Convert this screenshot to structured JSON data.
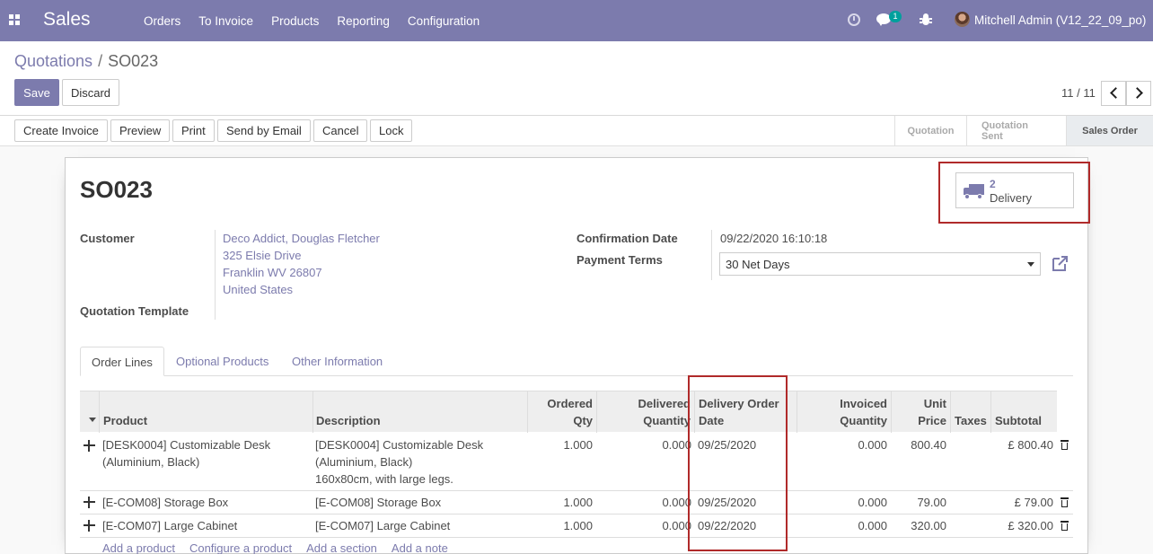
{
  "navbar": {
    "app_title": "Sales",
    "menu": [
      "Orders",
      "To Invoice",
      "Products",
      "Reporting",
      "Configuration"
    ],
    "chat_count": "1",
    "user": "Mitchell Admin (V12_22_09_po)"
  },
  "breadcrumb": {
    "parent": "Quotations",
    "separator": "/",
    "current": "SO023"
  },
  "buttons": {
    "save": "Save",
    "discard": "Discard"
  },
  "pager": {
    "value": "11 / 11"
  },
  "status_actions": [
    "Create Invoice",
    "Preview",
    "Print",
    "Send by Email",
    "Cancel",
    "Lock"
  ],
  "stages": [
    "Quotation",
    "Quotation Sent",
    "Sales Order"
  ],
  "record": {
    "name": "SO023",
    "smart_button": {
      "value": "2",
      "label": "Delivery"
    },
    "customer_label": "Customer",
    "customer_lines": [
      "Deco Addict, Douglas Fletcher",
      "325 Elsie Drive",
      "Franklin WV 26807",
      "United States"
    ],
    "template_label": "Quotation Template",
    "confirmation_label": "Confirmation Date",
    "confirmation_value": "09/22/2020 16:10:18",
    "payment_label": "Payment Terms",
    "payment_value": "30 Net Days"
  },
  "tabs": [
    "Order Lines",
    "Optional Products",
    "Other Information"
  ],
  "table": {
    "headers": {
      "product": "Product",
      "description": "Description",
      "ordered_1": "Ordered",
      "ordered_2": "Qty",
      "delivered_1": "Delivered",
      "delivered_2": "Quantity",
      "delivery_date_1": "Delivery Order",
      "delivery_date_2": "Date",
      "invoiced_1": "Invoiced",
      "invoiced_2": "Quantity",
      "price_1": "Unit",
      "price_2": "Price",
      "taxes": "Taxes",
      "subtotal": "Subtotal"
    },
    "rows": [
      {
        "product_1": "[DESK0004] Customizable Desk",
        "product_2": "(Aluminium, Black)",
        "desc_1": "[DESK0004] Customizable Desk",
        "desc_2": "(Aluminium, Black)",
        "desc_3": "160x80cm, with large legs.",
        "ordered": "1.000",
        "delivered": "0.000",
        "delivery_date": "09/25/2020",
        "invoiced": "0.000",
        "price": "800.40",
        "subtotal": "£ 800.40"
      },
      {
        "product_1": "[E-COM08] Storage Box",
        "desc_1": "[E-COM08] Storage Box",
        "ordered": "1.000",
        "delivered": "0.000",
        "delivery_date": "09/25/2020",
        "invoiced": "0.000",
        "price": "79.00",
        "subtotal": "£ 79.00"
      },
      {
        "product_1": "[E-COM07] Large Cabinet",
        "desc_1": "[E-COM07] Large Cabinet",
        "ordered": "1.000",
        "delivered": "0.000",
        "delivery_date": "09/22/2020",
        "invoiced": "0.000",
        "price": "320.00",
        "subtotal": "£ 320.00"
      }
    ],
    "add_links": [
      "Add a product",
      "Configure a product",
      "Add a section",
      "Add a note"
    ]
  },
  "colors": {
    "brand": "#7c7bad",
    "highlight": "#b02a2a"
  }
}
